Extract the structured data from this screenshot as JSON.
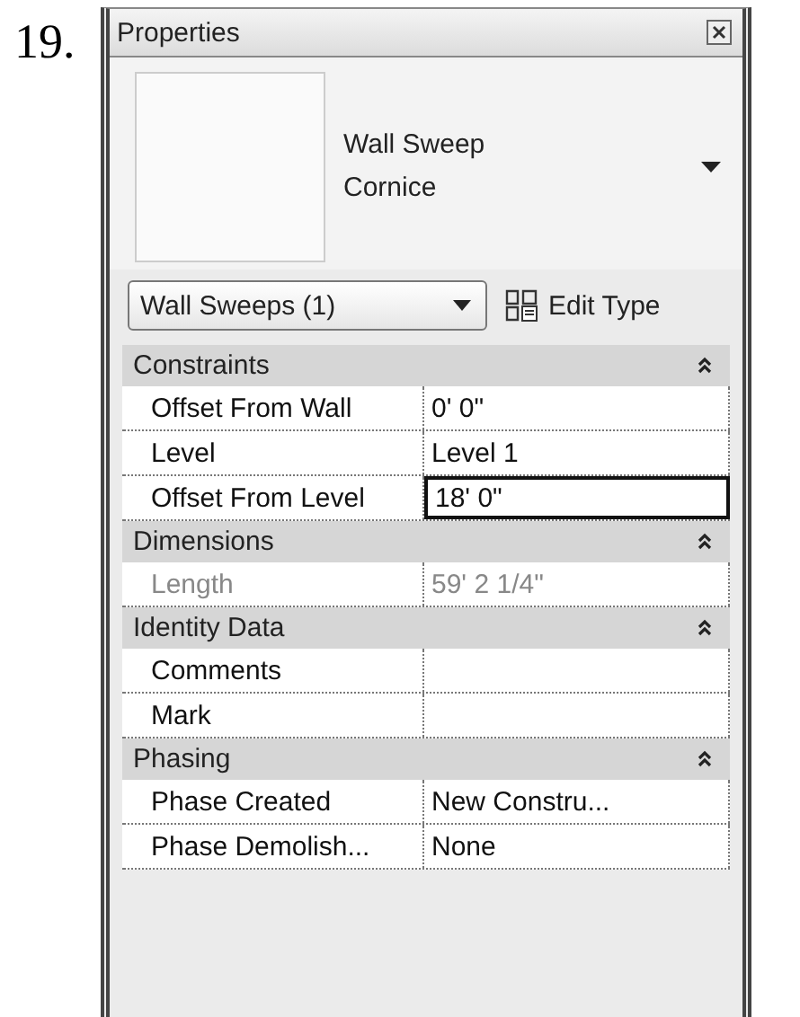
{
  "item_number": "19.",
  "panel": {
    "title": "Properties",
    "type_selector": {
      "family": "Wall Sweep",
      "type": "Cornice"
    },
    "filter": {
      "value": "Wall Sweeps (1)"
    },
    "edit_type_button": "Edit Type",
    "groups": [
      {
        "name": "Constraints",
        "expanded": true,
        "properties": [
          {
            "name": "Offset From Wall",
            "value": "0'  0\"",
            "disabled": false,
            "selected": false
          },
          {
            "name": "Level",
            "value": "Level 1",
            "disabled": false,
            "selected": false
          },
          {
            "name": "Offset From Level",
            "value": "18'  0\"",
            "disabled": false,
            "selected": true
          }
        ]
      },
      {
        "name": "Dimensions",
        "expanded": true,
        "properties": [
          {
            "name": "Length",
            "value": "59'  2 1/4\"",
            "disabled": true,
            "selected": false
          }
        ]
      },
      {
        "name": "Identity Data",
        "expanded": true,
        "properties": [
          {
            "name": "Comments",
            "disabled": false,
            "selected": false
          },
          {
            "name": "Mark",
            "disabled": false,
            "selected": false
          }
        ]
      },
      {
        "name": "Phasing",
        "expanded": true,
        "properties": [
          {
            "name": "Phase Created",
            "value": "New Constru...",
            "disabled": false,
            "selected": false
          },
          {
            "name": "Phase Demolish...",
            "value": "None",
            "disabled": false,
            "selected": false
          }
        ]
      }
    ]
  }
}
